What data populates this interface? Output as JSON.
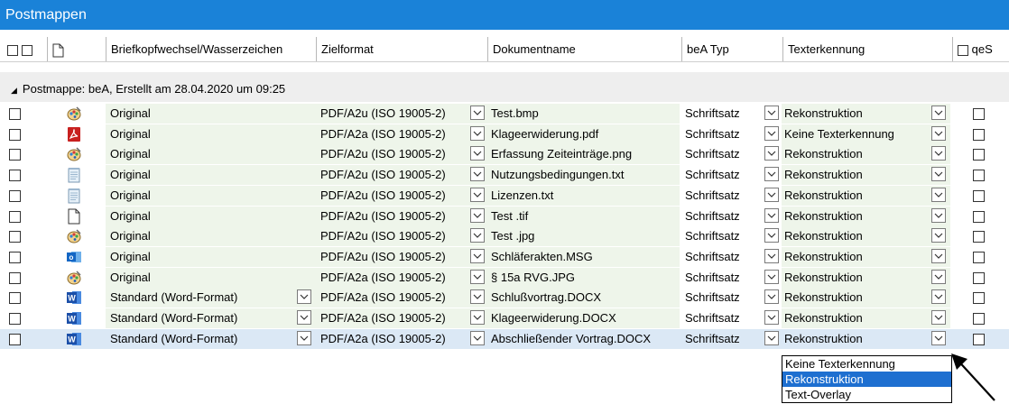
{
  "window": {
    "title": "Postmappen"
  },
  "columns": {
    "briefkopf": "Briefkopfwechsel/Wasserzeichen",
    "zielformat": "Zielformat",
    "dokumentname": "Dokumentname",
    "bea_typ": "beA Typ",
    "texterkennung": "Texterkennung",
    "qes": "qeS"
  },
  "group": {
    "label": "Postmappe: beA, Erstellt am 28.04.2020 um 09:25"
  },
  "rows": [
    {
      "icon": "image-file-icon",
      "briefkopf": "Original",
      "briefkopf_dropdown": false,
      "zielformat": "PDF/A2u (ISO 19005-2)",
      "dokument": "Test.bmp",
      "bea_typ": "Schriftsatz",
      "texterkennung": "Rekonstruktion"
    },
    {
      "icon": "pdf-file-icon",
      "briefkopf": "Original",
      "briefkopf_dropdown": false,
      "zielformat": "PDF/A2a (ISO 19005-2)",
      "dokument": "Klageerwiderung.pdf",
      "bea_typ": "Schriftsatz",
      "texterkennung": "Keine Texterkennung"
    },
    {
      "icon": "image-file-icon",
      "briefkopf": "Original",
      "briefkopf_dropdown": false,
      "zielformat": "PDF/A2u (ISO 19005-2)",
      "dokument": "Erfassung Zeiteinträge.png",
      "bea_typ": "Schriftsatz",
      "texterkennung": "Rekonstruktion"
    },
    {
      "icon": "text-file-icon",
      "briefkopf": "Original",
      "briefkopf_dropdown": false,
      "zielformat": "PDF/A2u (ISO 19005-2)",
      "dokument": "Nutzungsbedingungen.txt",
      "bea_typ": "Schriftsatz",
      "texterkennung": "Rekonstruktion"
    },
    {
      "icon": "text-file-icon",
      "briefkopf": "Original",
      "briefkopf_dropdown": false,
      "zielformat": "PDF/A2u (ISO 19005-2)",
      "dokument": "Lizenzen.txt",
      "bea_typ": "Schriftsatz",
      "texterkennung": "Rekonstruktion"
    },
    {
      "icon": "blank-file-icon",
      "briefkopf": "Original",
      "briefkopf_dropdown": false,
      "zielformat": "PDF/A2u (ISO 19005-2)",
      "dokument": "Test .tif",
      "bea_typ": "Schriftsatz",
      "texterkennung": "Rekonstruktion"
    },
    {
      "icon": "image-file-icon",
      "briefkopf": "Original",
      "briefkopf_dropdown": false,
      "zielformat": "PDF/A2u (ISO 19005-2)",
      "dokument": "Test .jpg",
      "bea_typ": "Schriftsatz",
      "texterkennung": "Rekonstruktion"
    },
    {
      "icon": "outlook-file-icon",
      "briefkopf": "Original",
      "briefkopf_dropdown": false,
      "zielformat": "PDF/A2u (ISO 19005-2)",
      "dokument": "Schläferakten.MSG",
      "bea_typ": "Schriftsatz",
      "texterkennung": "Rekonstruktion"
    },
    {
      "icon": "image-file-icon",
      "briefkopf": "Original",
      "briefkopf_dropdown": false,
      "zielformat": "PDF/A2a (ISO 19005-2)",
      "dokument": "§ 15a RVG.JPG",
      "bea_typ": "Schriftsatz",
      "texterkennung": "Rekonstruktion"
    },
    {
      "icon": "word-file-icon",
      "briefkopf": "Standard (Word-Format)",
      "briefkopf_dropdown": true,
      "zielformat": "PDF/A2a (ISO 19005-2)",
      "dokument": "Schlußvortrag.DOCX",
      "bea_typ": "Schriftsatz",
      "texterkennung": "Rekonstruktion"
    },
    {
      "icon": "word-file-icon",
      "briefkopf": "Standard (Word-Format)",
      "briefkopf_dropdown": true,
      "zielformat": "PDF/A2a (ISO 19005-2)",
      "dokument": "Klageerwiderung.DOCX",
      "bea_typ": "Schriftsatz",
      "texterkennung": "Rekonstruktion"
    },
    {
      "icon": "word-file-icon",
      "briefkopf": "Standard (Word-Format)",
      "briefkopf_dropdown": true,
      "zielformat": "PDF/A2a (ISO 19005-2)",
      "dokument": "Abschließender Vortrag.DOCX",
      "bea_typ": "Schriftsatz",
      "texterkennung": "Rekonstruktion",
      "selected": true
    }
  ],
  "ocr_popup": {
    "options": [
      "Keine Texterkennung",
      "Rekonstruktion",
      "Text-Overlay"
    ],
    "highlighted": "Rekonstruktion"
  },
  "colors": {
    "titlebar": "#1a82d8",
    "row_green": "#eef5ea",
    "selected_row": "#dbe8f5",
    "popup_highlight": "#1e6fd0"
  }
}
